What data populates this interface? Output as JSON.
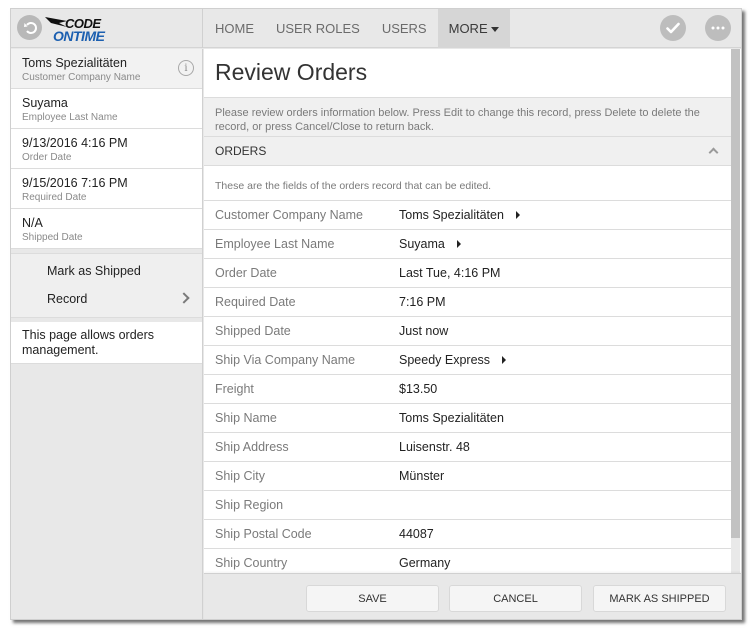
{
  "app": {
    "logo_line1": "CODE",
    "logo_line2": "ONTIME"
  },
  "nav": {
    "items": [
      {
        "label": "HOME"
      },
      {
        "label": "USER ROLES"
      },
      {
        "label": "USERS"
      },
      {
        "label": "MORE",
        "active": true
      }
    ],
    "icons": [
      "back-icon",
      "checkmark-icon",
      "more-icon"
    ]
  },
  "sidebar": {
    "summary": [
      {
        "value": "Toms Spezialitäten",
        "label": "Customer Company Name"
      },
      {
        "value": "Suyama",
        "label": "Employee Last Name"
      },
      {
        "value": "9/13/2016 4:16 PM",
        "label": "Order Date"
      },
      {
        "value": "9/15/2016 7:16 PM",
        "label": "Required Date"
      },
      {
        "value": "N/A",
        "label": "Shipped Date"
      }
    ],
    "info_icon": "i",
    "actions": [
      {
        "label": "Mark as Shipped"
      },
      {
        "label": "Record"
      }
    ],
    "note": "This page allows orders management."
  },
  "main": {
    "title": "Review Orders",
    "intro": "Please review orders information below. Press Edit to change this record, press Delete to delete the record, or press Cancel/Close to return back.",
    "section": {
      "title": "ORDERS",
      "description": "These are the fields of the orders record that can be edited.",
      "fields": [
        {
          "label": "Customer Company Name",
          "value": "Toms Spezialitäten",
          "lookup": true
        },
        {
          "label": "Employee Last Name",
          "value": "Suyama",
          "lookup": true
        },
        {
          "label": "Order Date",
          "value": "Last Tue, 4:16 PM",
          "lookup": false
        },
        {
          "label": "Required Date",
          "value": "7:16 PM",
          "lookup": false
        },
        {
          "label": "Shipped Date",
          "value": "Just now",
          "lookup": false
        },
        {
          "label": "Ship Via Company Name",
          "value": "Speedy Express",
          "lookup": true
        },
        {
          "label": "Freight",
          "value": "$13.50",
          "lookup": false
        },
        {
          "label": "Ship Name",
          "value": "Toms Spezialitäten",
          "lookup": false
        },
        {
          "label": "Ship Address",
          "value": "Luisenstr. 48",
          "lookup": false
        },
        {
          "label": "Ship City",
          "value": "Münster",
          "lookup": false
        },
        {
          "label": "Ship Region",
          "value": "",
          "lookup": false
        },
        {
          "label": "Ship Postal Code",
          "value": "44087",
          "lookup": false
        },
        {
          "label": "Ship Country",
          "value": "Germany",
          "lookup": false
        }
      ]
    }
  },
  "footer": {
    "save_label": "SAVE",
    "cancel_label": "CANCEL",
    "mark_shipped_label": "MARK AS SHIPPED"
  },
  "colors": {
    "chrome_bg": "#e8e8e8",
    "nav_active_bg": "#d6d6d6",
    "logo_blue": "#1b5fb0"
  }
}
